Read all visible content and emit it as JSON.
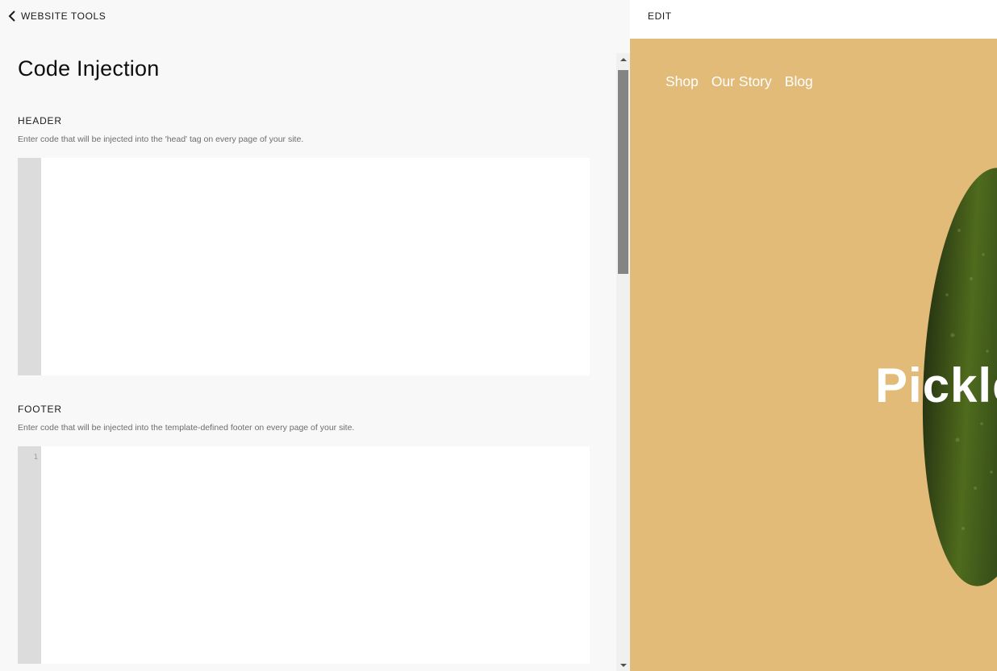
{
  "left_panel": {
    "back_label": "WEBSITE TOOLS",
    "title": "Code Injection",
    "sections": {
      "header": {
        "title": "HEADER",
        "description": "Enter code that will be injected into the 'head' tag on every page of your site."
      },
      "footer": {
        "title": "FOOTER",
        "description": "Enter code that will be injected into the template-defined footer on every page of your site.",
        "line_number": "1"
      }
    }
  },
  "preview": {
    "edit_label": "EDIT",
    "nav": [
      "Shop",
      "Our Story",
      "Blog"
    ],
    "hero_title": "Pickle",
    "background_color": "#e2bb78"
  },
  "icons": {
    "back": "chevron-left-icon",
    "scroll_up": "triangle-up-icon",
    "scroll_down": "triangle-down-icon"
  }
}
